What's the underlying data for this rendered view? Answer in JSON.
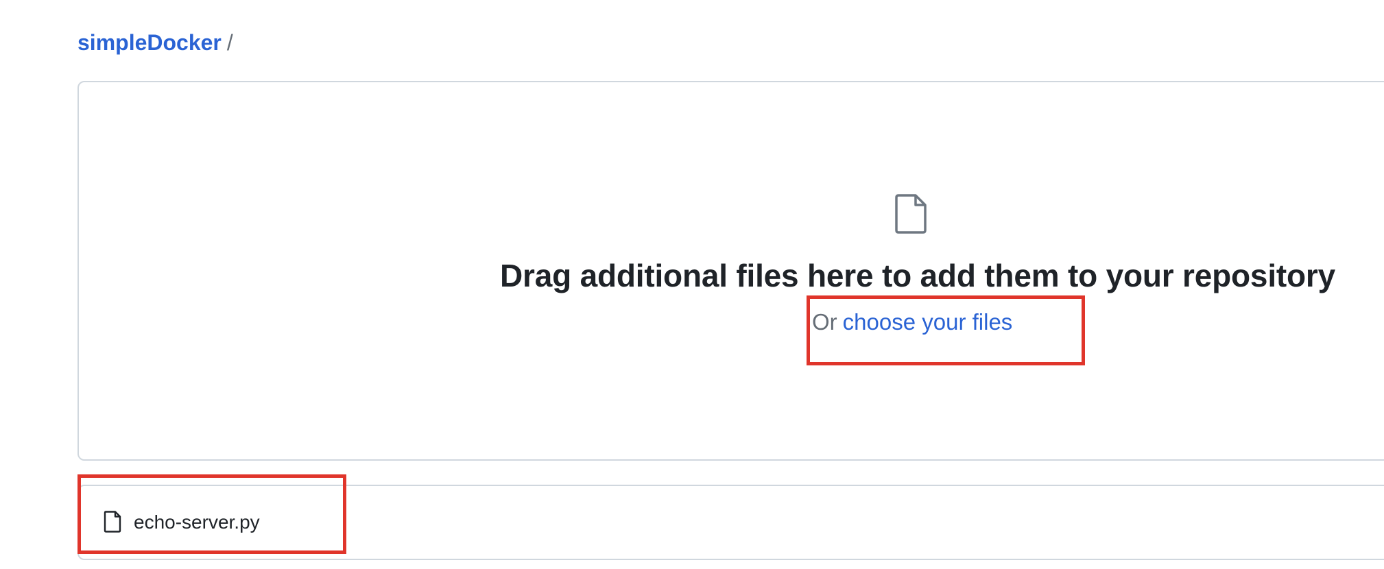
{
  "breadcrumb": {
    "repo": "simpleDocker",
    "separator": "/"
  },
  "dropzone": {
    "icon": "file-icon",
    "title": "Drag additional files here to add them to your repository",
    "or_text": "Or",
    "choose_link": "choose your files"
  },
  "files": [
    {
      "icon": "file-icon",
      "name": "echo-server.py"
    }
  ],
  "colors": {
    "link": "#2a63d4",
    "text": "#1f2328",
    "muted": "#656d76",
    "border": "#d0d7de",
    "highlight": "#e0352b"
  }
}
